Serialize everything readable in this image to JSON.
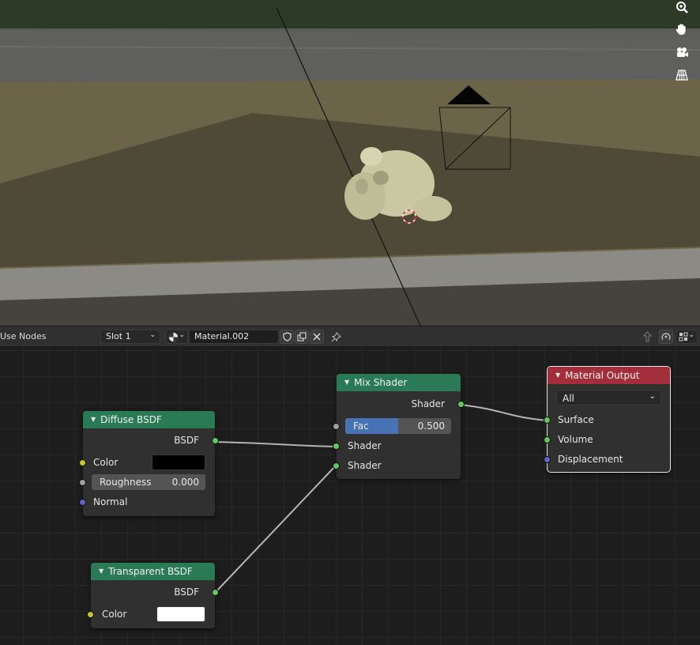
{
  "colors": {
    "shader_node_header": "#2a7a56",
    "output_node_header": "#a12e3a",
    "socket_shader": "#63c763",
    "socket_color": "#c7c729",
    "socket_float": "#a1a1a1",
    "socket_vector": "#6363c7",
    "fac_fill": "#4772b3",
    "link": "#b4b4b4"
  },
  "viewport": {
    "icons": [
      "zoom-icon",
      "hand-pan-icon",
      "camera-icon",
      "grid-ortho-icon"
    ]
  },
  "header": {
    "use_nodes_label": "Use Nodes",
    "slot_label": "Slot 1",
    "material_name": "Material.002",
    "icons": [
      "material-sphere-icon",
      "fake-user-shield-icon",
      "duplicate-icon",
      "close-icon",
      "pin-icon",
      "parent-up-icon",
      "snap-icon",
      "overlay-icon"
    ]
  },
  "nodes": {
    "diffuse": {
      "title": "Diffuse BSDF",
      "output": "BSDF",
      "color_label": "Color",
      "color_value": "#000000",
      "roughness_label": "Roughness",
      "roughness_value": "0.000",
      "normal_label": "Normal"
    },
    "transparent": {
      "title": "Transparent BSDF",
      "output": "BSDF",
      "color_label": "Color",
      "color_value": "#ffffff"
    },
    "mix": {
      "title": "Mix Shader",
      "output": "Shader",
      "fac_label": "Fac",
      "fac_value": "0.500",
      "fac_fraction": 0.5,
      "shader1_label": "Shader",
      "shader2_label": "Shader"
    },
    "output": {
      "title": "Material Output",
      "target": "All",
      "surface_label": "Surface",
      "volume_label": "Volume",
      "displacement_label": "Displacement"
    }
  }
}
